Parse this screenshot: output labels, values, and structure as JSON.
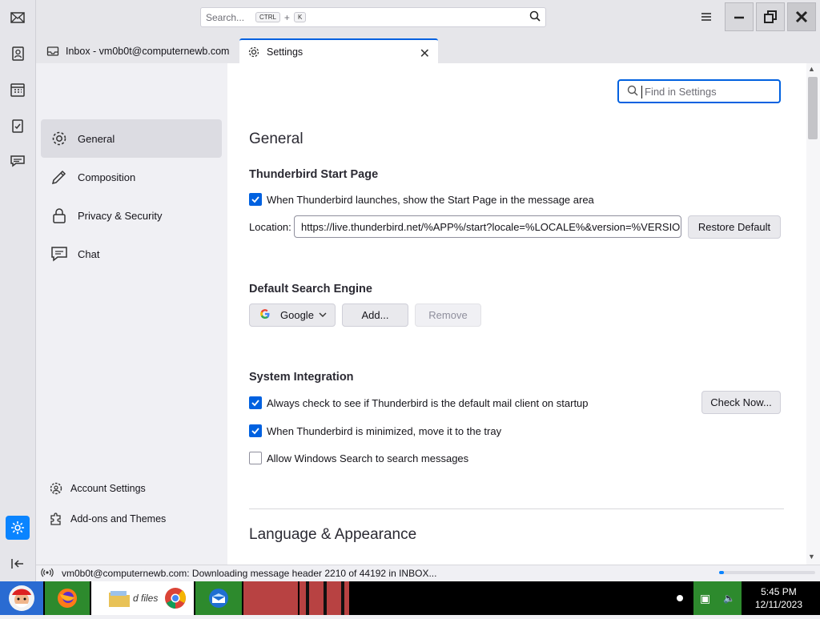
{
  "search": {
    "placeholder": "Search...",
    "key1": "CTRL",
    "plus": "+",
    "key2": "K"
  },
  "tabs": [
    {
      "label": "Inbox - vm0b0t@computernewb.com"
    },
    {
      "label": "Settings"
    }
  ],
  "sidebar": {
    "categories": [
      {
        "label": "General",
        "icon": "gear-icon",
        "selected": true
      },
      {
        "label": "Composition",
        "icon": "pencil-icon"
      },
      {
        "label": "Privacy & Security",
        "icon": "lock-icon"
      },
      {
        "label": "Chat",
        "icon": "chat-bubble-icon"
      }
    ],
    "footer": [
      {
        "label": "Account Settings",
        "icon": "account-gear-icon"
      },
      {
        "label": "Add-ons and Themes",
        "icon": "puzzle-icon"
      }
    ]
  },
  "find": {
    "placeholder": "Find in Settings"
  },
  "content": {
    "heading": "General",
    "start_page": {
      "title": "Thunderbird Start Page",
      "checkbox": "When Thunderbird launches, show the Start Page in the message area",
      "checked": true,
      "location_label": "Location:",
      "location_value": "https://live.thunderbird.net/%APP%/start?locale=%LOCALE%&version=%VERSIO",
      "restore_label": "Restore Default"
    },
    "search_engine": {
      "title": "Default Search Engine",
      "selected": "Google",
      "add_label": "Add...",
      "remove_label": "Remove"
    },
    "system": {
      "title": "System Integration",
      "items": [
        {
          "label": "Always check to see if Thunderbird is the default mail client on startup",
          "checked": true
        },
        {
          "label": "When Thunderbird is minimized, move it to the tray",
          "checked": true
        },
        {
          "label": "Allow Windows Search to search messages",
          "checked": false
        }
      ],
      "check_now_label": "Check Now..."
    },
    "language_heading": "Language & Appearance"
  },
  "status": {
    "text": "vm0b0t@computernewb.com: Downloading message header 2210 of 44192 in INBOX...",
    "progress": 0.05
  },
  "taskbar": {
    "time": "5:45 PM",
    "date": "12/11/2023",
    "file_label": "d files"
  },
  "colors": {
    "accent": "#0061e0"
  }
}
